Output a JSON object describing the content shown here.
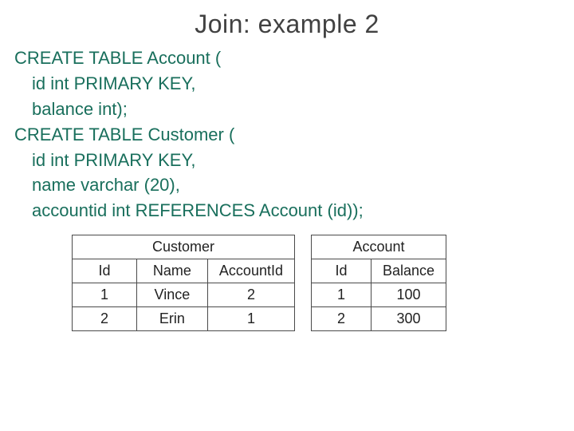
{
  "title": "Join: example 2",
  "sql": {
    "l1": "CREATE TABLE Account (",
    "l2": "id int PRIMARY KEY,",
    "l3": "balance int);",
    "l4": "CREATE TABLE Customer (",
    "l5": "id int PRIMARY KEY,",
    "l6": "name varchar (20),",
    "l7": "accountid int REFERENCES Account (id));"
  },
  "customer": {
    "caption": "Customer",
    "headers": {
      "c1": "Id",
      "c2": "Name",
      "c3": "AccountId"
    },
    "rows": [
      {
        "c1": "1",
        "c2": "Vince",
        "c3": "2"
      },
      {
        "c1": "2",
        "c2": "Erin",
        "c3": "1"
      }
    ]
  },
  "account": {
    "caption": "Account",
    "headers": {
      "c1": "Id",
      "c2": "Balance"
    },
    "rows": [
      {
        "c1": "1",
        "c2": "100"
      },
      {
        "c1": "2",
        "c2": "300"
      }
    ]
  }
}
